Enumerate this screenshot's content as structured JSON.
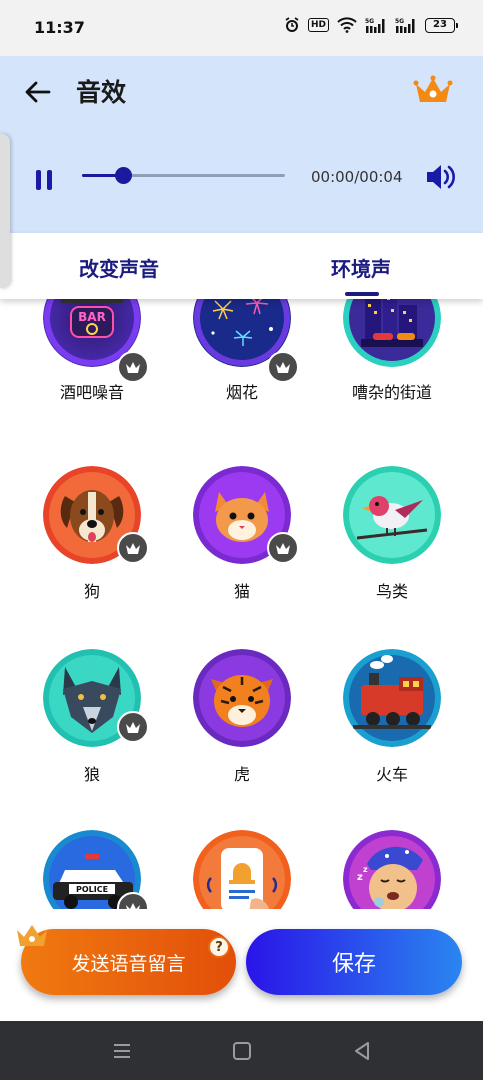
{
  "status_bar": {
    "time": "11:37",
    "hd": "HD",
    "battery": "23"
  },
  "header": {
    "title": "音效",
    "back_icon": "back-arrow-icon",
    "crown_icon": "premium-crown-icon",
    "accent": "#1a1a9c",
    "background": "#d4e4fb"
  },
  "player": {
    "time": "00:00/00:04",
    "progress": 0.2
  },
  "tabs": [
    {
      "label": "改变声音"
    },
    {
      "label": "环境声"
    }
  ],
  "sounds": [
    {
      "label": "酒吧噪音",
      "icon": "bar-sign-icon",
      "locked": true
    },
    {
      "label": "烟花",
      "icon": "fireworks-icon",
      "locked": true
    },
    {
      "label": "嘈杂的街道",
      "icon": "city-street-icon",
      "locked": false
    },
    {
      "label": "狗",
      "icon": "dog-icon",
      "locked": true
    },
    {
      "label": "猫",
      "icon": "cat-icon",
      "locked": true
    },
    {
      "label": "鸟类",
      "icon": "bird-icon",
      "locked": false
    },
    {
      "label": "狼",
      "icon": "wolf-icon",
      "locked": true
    },
    {
      "label": "虎",
      "icon": "tiger-icon",
      "locked": false
    },
    {
      "label": "火车",
      "icon": "train-icon",
      "locked": false
    },
    {
      "label": "",
      "icon": "police-car-icon",
      "locked": true
    },
    {
      "label": "",
      "icon": "doorbell-icon",
      "locked": false
    },
    {
      "label": "",
      "icon": "snoring-icon",
      "locked": false
    }
  ],
  "actions": {
    "voice_message": "发送语音留言",
    "help": "?",
    "save": "保存"
  }
}
